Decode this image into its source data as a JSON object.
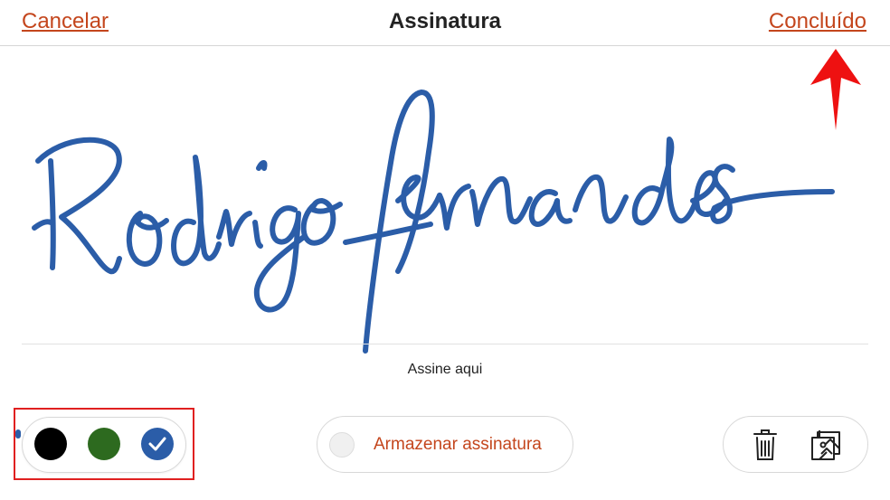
{
  "header": {
    "cancel_label": "Cancelar",
    "title": "Assinatura",
    "done_label": "Concluído"
  },
  "canvas": {
    "signature_text": "Rodrigo fernandes",
    "hint": "Assine aqui",
    "ink_color": "#2b5da8"
  },
  "color_picker": {
    "colors": [
      {
        "name": "black",
        "hex": "#000000",
        "selected": false
      },
      {
        "name": "green",
        "hex": "#2d6a1f",
        "selected": false
      },
      {
        "name": "blue",
        "hex": "#2b5da8",
        "selected": true
      }
    ],
    "selected_icon": "checkmark-icon"
  },
  "store": {
    "label": "Armazenar assinatura"
  },
  "tools": {
    "delete_icon": "trash-icon",
    "image_icon": "image-gallery-icon"
  },
  "annotation": {
    "arrow_color": "#ee1111",
    "highlight_color": "#e02020"
  },
  "accent": "#c4461d"
}
